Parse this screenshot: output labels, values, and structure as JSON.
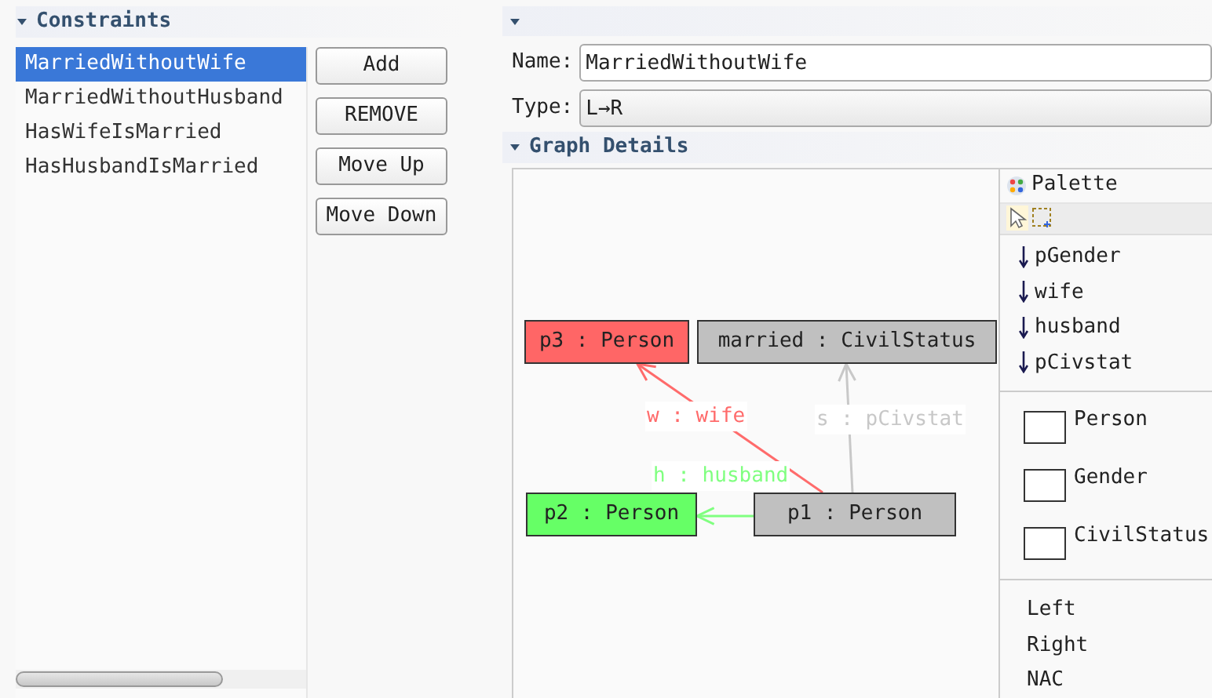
{
  "constraints": {
    "title": "Constraints",
    "expanded": true,
    "items": [
      {
        "label": "MarriedWithoutWife",
        "selected": true
      },
      {
        "label": "MarriedWithoutHusband",
        "selected": false
      },
      {
        "label": "HasWifeIsMarried",
        "selected": false
      },
      {
        "label": "HasHusbandIsMarried",
        "selected": false
      }
    ],
    "buttons": [
      "Add",
      "REMOVE",
      "Move Up",
      "Move Down"
    ]
  },
  "details": {
    "expanded": true,
    "name_label": "Name:",
    "name_value": "MarriedWithoutWife",
    "type_label": "Type:",
    "type_value": "L→R"
  },
  "graph": {
    "title": "Graph Details",
    "expanded": true,
    "nodes": [
      {
        "label": "p3 : Person",
        "color": "#ff6666"
      },
      {
        "label": "married : CivilStatus",
        "color": "#c0c0c0"
      },
      {
        "label": "p2 : Person",
        "color": "#66ff66"
      },
      {
        "label": "p1 : Person",
        "color": "#c0c0c0"
      }
    ],
    "edges": [
      {
        "label": "w : wife",
        "color": "#ff6b6b"
      },
      {
        "label": "h : husband",
        "color": "#80ff80"
      },
      {
        "label": "s : pCivstat",
        "color": "#c8c8c8"
      }
    ]
  },
  "palette": {
    "title": "Palette",
    "edges": [
      "pGender",
      "wife",
      "husband",
      "pCivstat"
    ],
    "nodes": [
      "Person",
      "Gender",
      "CivilStatus"
    ],
    "sections": [
      "Left",
      "Right",
      "NAC"
    ]
  }
}
